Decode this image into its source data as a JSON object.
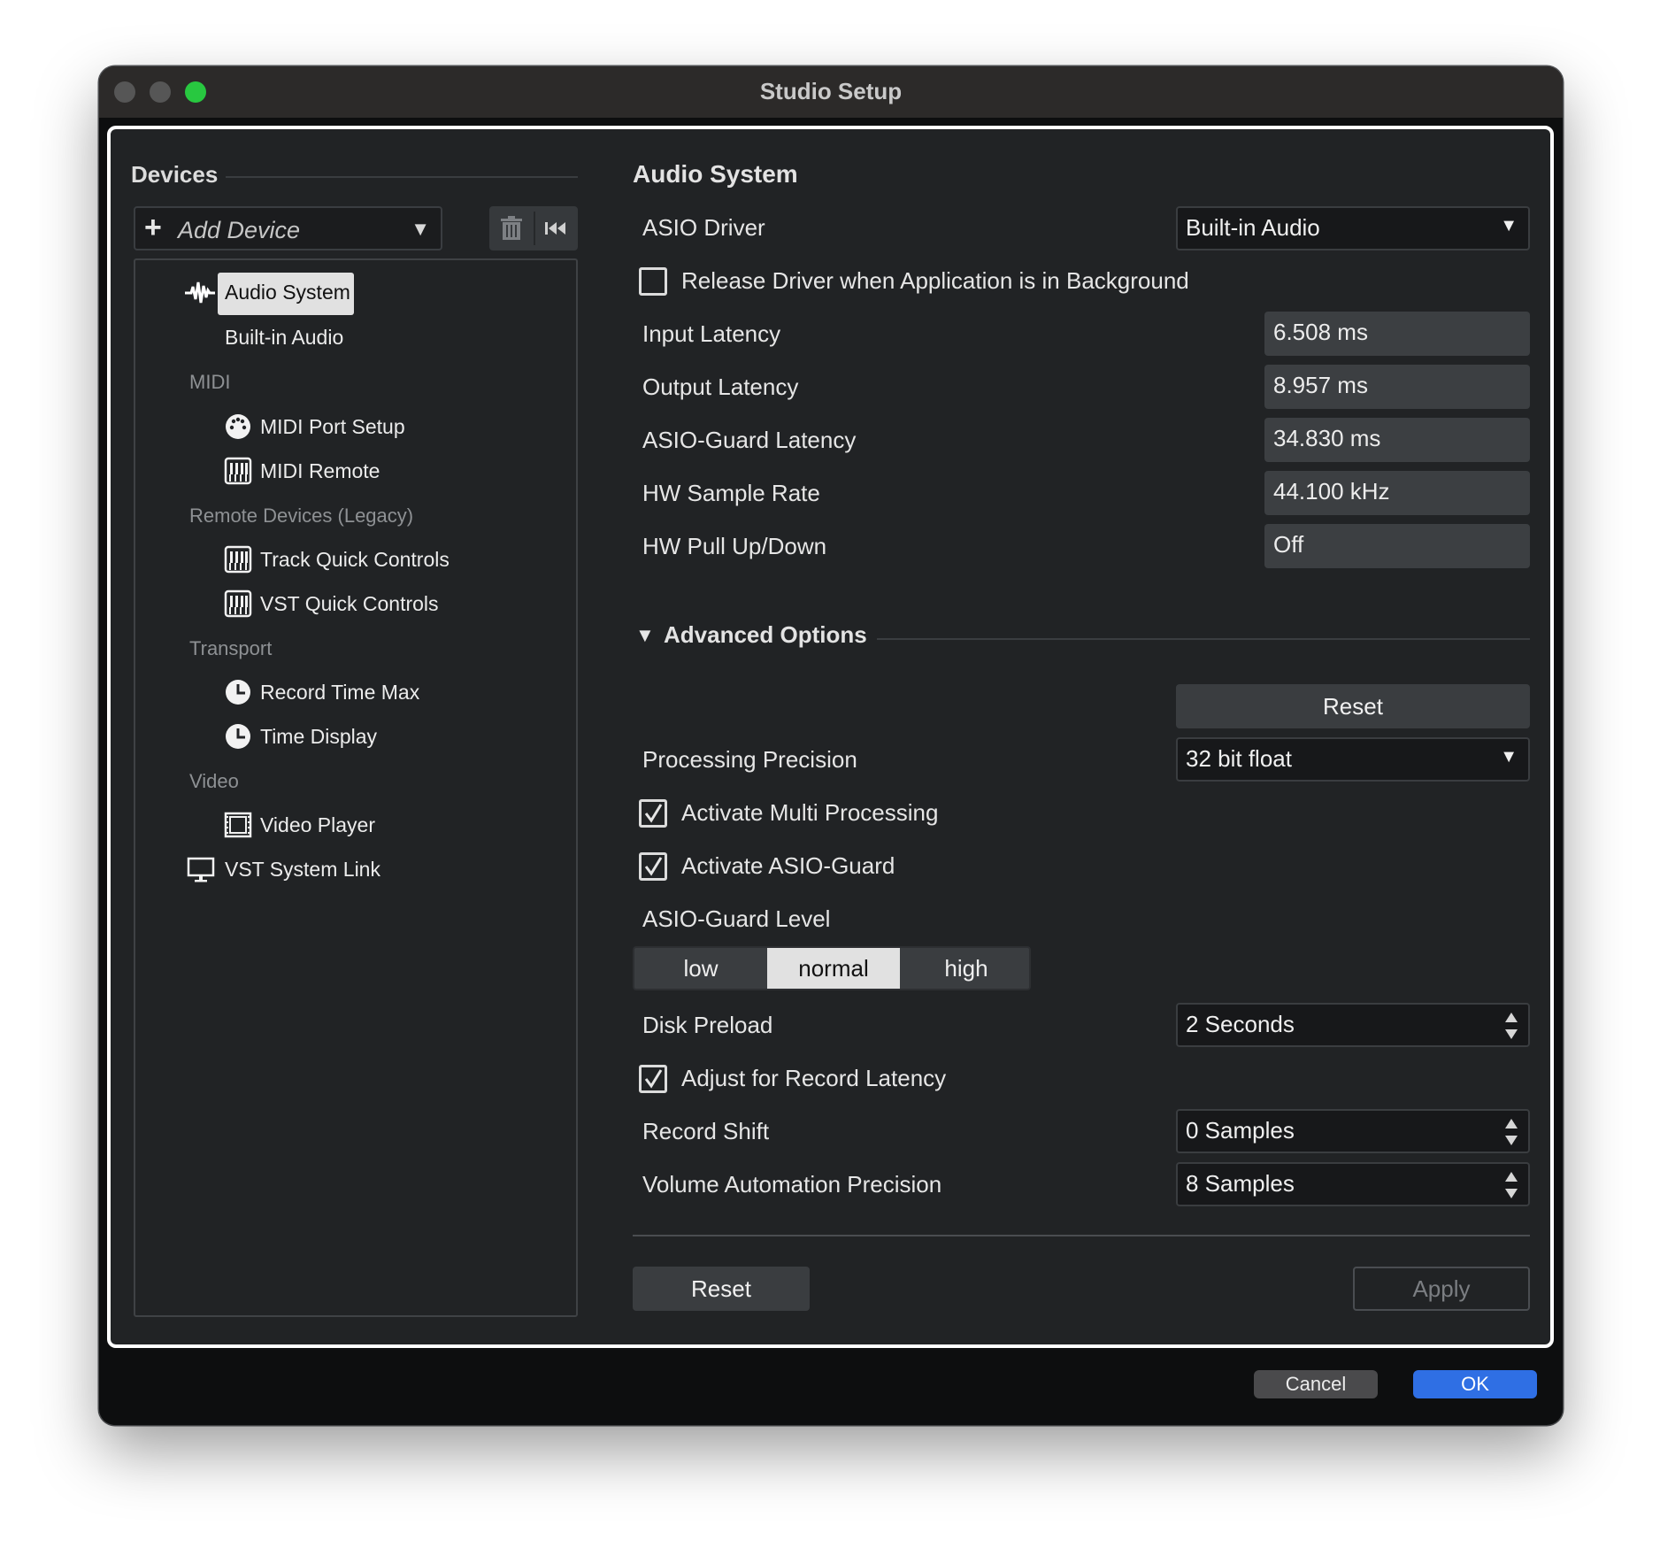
{
  "window": {
    "title": "Studio Setup"
  },
  "devices_panel": {
    "title": "Devices",
    "add_device_label": "Add Device",
    "tree": {
      "audio_system": "Audio System",
      "built_in_audio": "Built-in Audio",
      "midi_category": "MIDI",
      "midi_port_setup": "MIDI Port Setup",
      "midi_remote": "MIDI Remote",
      "remote_devices_category": "Remote Devices (Legacy)",
      "track_quick_controls": "Track Quick Controls",
      "vst_quick_controls": "VST Quick Controls",
      "transport_category": "Transport",
      "record_time_max": "Record Time Max",
      "time_display": "Time Display",
      "video_category": "Video",
      "video_player": "Video Player",
      "vst_system_link": "VST System Link"
    }
  },
  "audio_system": {
    "title": "Audio System",
    "asio_driver_label": "ASIO Driver",
    "asio_driver_value": "Built-in Audio",
    "release_driver_label": "Release Driver when Application is in Background",
    "release_driver_checked": false,
    "input_latency_label": "Input Latency",
    "input_latency_value": "6.508 ms",
    "output_latency_label": "Output Latency",
    "output_latency_value": "8.957 ms",
    "asio_guard_latency_label": "ASIO-Guard Latency",
    "asio_guard_latency_value": "34.830 ms",
    "hw_sample_rate_label": "HW Sample Rate",
    "hw_sample_rate_value": "44.100 kHz",
    "hw_pull_label": "HW Pull Up/Down",
    "hw_pull_value": "Off"
  },
  "advanced": {
    "title": "Advanced Options",
    "reset_label": "Reset",
    "processing_precision_label": "Processing Precision",
    "processing_precision_value": "32 bit float",
    "multi_processing_label": "Activate Multi Processing",
    "multi_processing_checked": true,
    "asio_guard_label": "Activate ASIO-Guard",
    "asio_guard_checked": true,
    "asio_guard_level_label": "ASIO-Guard Level",
    "asio_guard_levels": [
      "low",
      "normal",
      "high"
    ],
    "asio_guard_level_selected": "normal",
    "disk_preload_label": "Disk Preload",
    "disk_preload_value": "2 Seconds",
    "adjust_record_latency_label": "Adjust for Record Latency",
    "adjust_record_latency_checked": true,
    "record_shift_label": "Record Shift",
    "record_shift_value": "0 Samples",
    "volume_automation_label": "Volume Automation Precision",
    "volume_automation_value": "8 Samples"
  },
  "panel_buttons": {
    "reset_label": "Reset",
    "apply_label": "Apply"
  },
  "dialog_buttons": {
    "cancel_label": "Cancel",
    "ok_label": "OK"
  },
  "colors": {
    "accent": "#2f6fe4",
    "selected_bg": "#e1e1e1",
    "close_green": "#28c840"
  },
  "icons": [
    "waveform-icon",
    "midi-port-icon",
    "keyboard-icon",
    "clock-icon",
    "film-icon",
    "monitor-icon",
    "trash-icon",
    "rewind-icon",
    "plus-icon",
    "dropdown-arrow-icon",
    "spinner-icon",
    "checkmark-icon",
    "disclosure-triangle-icon"
  ]
}
